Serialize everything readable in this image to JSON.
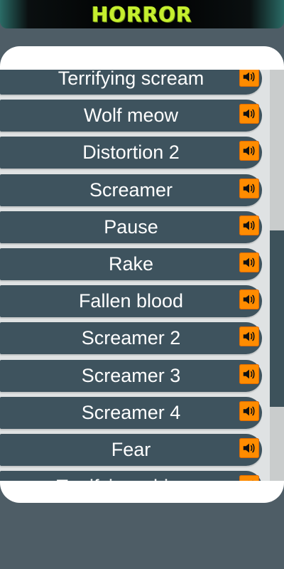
{
  "header": {
    "title": "HORROR"
  },
  "sound_list": {
    "items": [
      {
        "label": "Terrifying scream"
      },
      {
        "label": "Wolf meow"
      },
      {
        "label": "Distortion 2"
      },
      {
        "label": "Screamer"
      },
      {
        "label": "Pause"
      },
      {
        "label": "Rake"
      },
      {
        "label": "Fallen blood"
      },
      {
        "label": "Screamer 2"
      },
      {
        "label": "Screamer 3"
      },
      {
        "label": "Screamer 4"
      },
      {
        "label": "Fear"
      },
      {
        "label": "Terrifying whisper"
      }
    ],
    "play_icon": "speaker-icon"
  },
  "colors": {
    "background": "#4e5d66",
    "row": "#3e535e",
    "play_button": "#ff8c00",
    "logo": "#c6ef2f"
  }
}
